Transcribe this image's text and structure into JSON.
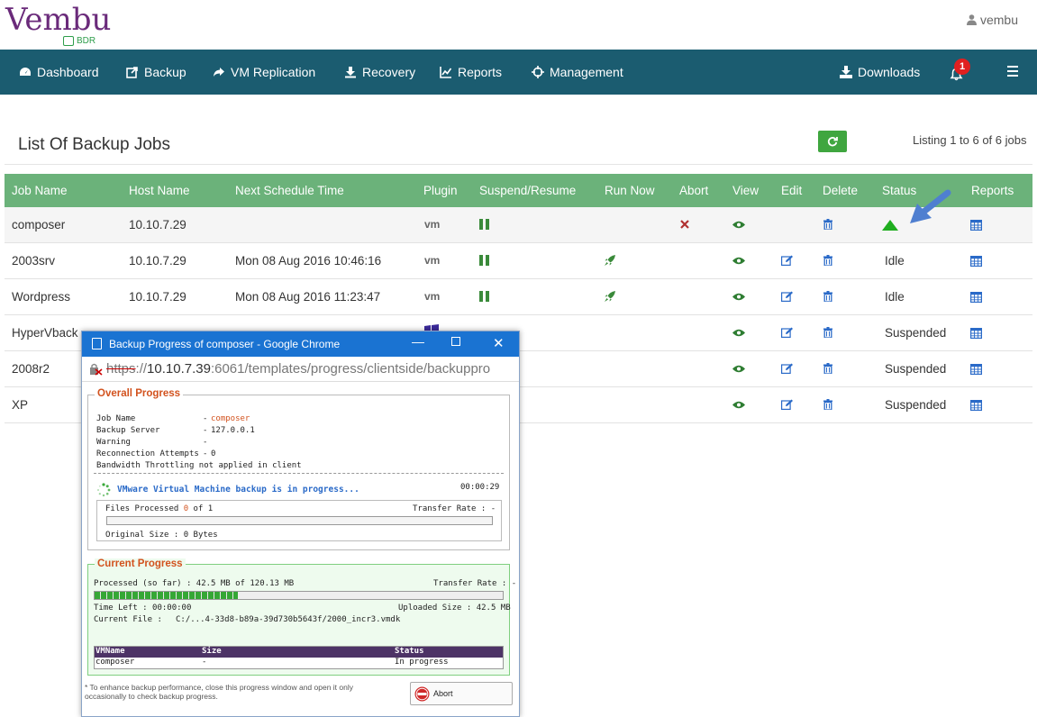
{
  "brand": {
    "logo": "Vembu",
    "sub": "BDR"
  },
  "user": {
    "name": "vembu"
  },
  "nav": {
    "items": [
      {
        "label": "Dashboard",
        "icon": "dashboard-icon"
      },
      {
        "label": "Backup",
        "icon": "backup-icon"
      },
      {
        "label": "VM Replication",
        "icon": "share-icon"
      },
      {
        "label": "Recovery",
        "icon": "download-icon"
      },
      {
        "label": "Reports",
        "icon": "line-chart-icon"
      },
      {
        "label": "Management",
        "icon": "crosshair-icon"
      }
    ],
    "downloads": "Downloads",
    "notification_count": "1"
  },
  "page": {
    "title": "List Of Backup Jobs",
    "listing": "Listing 1 to 6 of 6 jobs"
  },
  "table": {
    "headers": [
      "Job Name",
      "Host Name",
      "Next Schedule Time",
      "Plugin",
      "Suspend/Resume",
      "Run Now",
      "Abort",
      "View",
      "Edit",
      "Delete",
      "Status",
      "Reports"
    ],
    "rows": [
      {
        "job": "composer",
        "host": "10.10.7.29",
        "next": "",
        "plugin": "vm",
        "status": ""
      },
      {
        "job": "2003srv",
        "host": "10.10.7.29",
        "next": "Mon 08 Aug 2016 10:46:16",
        "plugin": "vm",
        "status": "Idle"
      },
      {
        "job": "Wordpress",
        "host": "10.10.7.29",
        "next": "Mon 08 Aug 2016 11:23:47",
        "plugin": "vm",
        "status": "Idle"
      },
      {
        "job": "HyperVback",
        "host": "",
        "next": "",
        "plugin": "windows",
        "status": "Suspended"
      },
      {
        "job": "2008r2",
        "host": "",
        "next": "",
        "plugin": "",
        "status": "Suspended"
      },
      {
        "job": "XP",
        "host": "",
        "next": "",
        "plugin": "",
        "status": "Suspended"
      }
    ]
  },
  "colors": {
    "nav": "#1b5c70",
    "table_header": "#6bb27a",
    "accent_green": "#3fa63f",
    "popup_title": "#1a73d2"
  },
  "popup": {
    "title": "Backup Progress of composer - Google Chrome",
    "url_scheme": "https",
    "url_host": "10.10.7.39",
    "url_rest": ":6061/templates/progress/clientside/backuppro",
    "overall": {
      "legend": "Overall Progress",
      "fields": [
        {
          "label": "Job Name",
          "value": "composer"
        },
        {
          "label": "Backup Server",
          "value": "127.0.0.1"
        },
        {
          "label": "Warning",
          "value": ""
        },
        {
          "label": "Reconnection Attempts",
          "value": "0"
        }
      ],
      "throttle_note": "Bandwidth Throttling not applied in client",
      "message": "VMware Virtual Machine backup is in progress...",
      "elapsed": "00:00:29",
      "files_processed_label": "Files Processed",
      "files_done": "0",
      "files_of": "of 1",
      "transfer_rate": "Transfer Rate : -",
      "original_size": "Original Size : 0 Bytes"
    },
    "current": {
      "legend": "Current Progress",
      "processed": "Processed (so far) : 42.5 MB  of  120.13 MB",
      "transfer_rate": "Transfer Rate : -",
      "progress_fraction": 0.35,
      "time_left": "Time Left : 00:00:00",
      "uploaded": "Uploaded Size : 42.5 MB",
      "current_file_label": "Current File :",
      "current_file": "C:/...4-33d8-b89a-39d730b5643f/2000_incr3.vmdk",
      "vm_headers": [
        "VMName",
        "Size",
        "Status"
      ],
      "vm_row": [
        "composer",
        "-",
        "In progress"
      ]
    },
    "note": "* To enhance backup performance, close this progress window and open it only occasionally to check backup progress.",
    "abort_label": "Abort"
  }
}
